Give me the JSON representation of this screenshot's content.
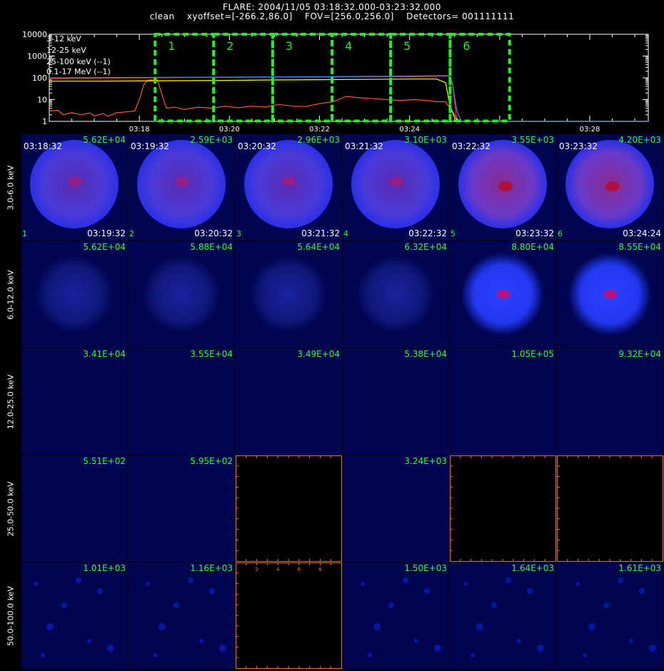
{
  "title_line1": "FLARE: 2004/11/05 03:18:32.000-03:23:32.000",
  "title_line2": "clean    xyoffset=[-266.2,86.0]    FOV=[256.0,256.0]    Detectors= 001111111",
  "chart_data": {
    "type": "line",
    "x_unit": "minutes after 03:16",
    "xlim": [
      0,
      13.3
    ],
    "x_ticks": [
      2,
      4,
      6,
      8,
      12
    ],
    "x_tick_labels": [
      "03:18",
      "03:20",
      "03:22",
      "03:24",
      "03:28"
    ],
    "yscale": "log",
    "ylim": [
      1,
      10000
    ],
    "y_ticks": [
      1,
      10,
      100,
      1000,
      10000
    ],
    "y_tick_labels": [
      "1",
      "10",
      "100",
      "1000",
      "10000"
    ],
    "legend_placement": "top-left",
    "series": [
      {
        "name": "3-12 keV",
        "color": "#ff2020",
        "x": [
          0,
          0.5,
          0.6,
          0.8,
          1.0,
          1.1,
          1.3,
          1.5,
          1.7,
          2.0,
          2.2,
          2.4,
          2.7,
          3.0,
          3.5,
          4.0,
          5.0,
          6.0,
          7.0,
          8.0,
          8.7,
          8.85,
          8.95,
          9.05,
          9.15,
          13.3
        ],
        "y": [
          90,
          92,
          95,
          93,
          96,
          95,
          97,
          96,
          98,
          98,
          100,
          100,
          101,
          102,
          104,
          105,
          106,
          108,
          110,
          112,
          120,
          120,
          60,
          1,
          1,
          1
        ]
      },
      {
        "name": "12-25 keV",
        "color": "#ff5a1e",
        "x": [
          0,
          0.2,
          0.3,
          0.5,
          0.7,
          0.9,
          1.0,
          1.2,
          1.3,
          1.5,
          1.7,
          1.9,
          2.0,
          2.1,
          2.2,
          2.4,
          2.6,
          2.8,
          3.0,
          3.3,
          3.6,
          3.9,
          4.2,
          4.5,
          4.8,
          5.1,
          5.4,
          5.7,
          6.0,
          6.3,
          6.6,
          6.9,
          7.2,
          7.5,
          7.8,
          8.1,
          8.4,
          8.6,
          8.8,
          8.9,
          9.0,
          9.1,
          13.3
        ],
        "y": [
          3,
          3.2,
          2,
          2.5,
          2,
          2.4,
          1.8,
          2.3,
          1.7,
          2.5,
          2.7,
          3,
          10,
          50,
          80,
          80,
          4,
          4.5,
          3.5,
          4.5,
          4,
          5,
          4.2,
          5,
          4.5,
          6,
          5,
          4.8,
          6.5,
          8,
          14,
          12,
          11,
          10,
          9,
          10,
          9,
          8,
          8,
          4,
          2,
          1,
          1
        ]
      },
      {
        "name": "25-100 keV (--1)",
        "color": "#ffff00",
        "x": [
          0,
          1,
          2,
          3,
          4,
          5,
          6,
          7,
          8,
          8.6,
          8.8,
          8.9,
          9.0,
          9.1,
          13.3
        ],
        "y": [
          70,
          70,
          72,
          74,
          76,
          80,
          82,
          85,
          88,
          88,
          60,
          5,
          1.5,
          1,
          1
        ]
      },
      {
        "name": "0.1-17 MeV (--1)",
        "color": "#2a8cff",
        "x": [
          0,
          1,
          2,
          3,
          4,
          5,
          6,
          7,
          8,
          8.7,
          8.85,
          8.95,
          9.05,
          9.15,
          13.3
        ],
        "y": [
          100,
          102,
          104,
          106,
          108,
          110,
          112,
          116,
          120,
          125,
          125,
          60,
          3,
          1,
          1
        ]
      }
    ],
    "intervals": [
      {
        "label": "1",
        "x": [
          2.35,
          3.65
        ]
      },
      {
        "label": "2",
        "x": [
          3.65,
          4.96
        ]
      },
      {
        "label": "3",
        "x": [
          4.96,
          6.28
        ]
      },
      {
        "label": "4",
        "x": [
          6.28,
          7.58
        ]
      },
      {
        "label": "5",
        "x": [
          7.58,
          8.9
        ]
      },
      {
        "label": "6",
        "x": [
          8.9,
          10.22
        ]
      }
    ]
  },
  "energy_bands": [
    "3.0-6.0 keV",
    "6.0-12.0 keV",
    "12.0-25.0 keV",
    "25.0-50.0 keV",
    "50.0-100.0 keV"
  ],
  "time_starts": [
    "03:18:32",
    "03:19:32",
    "03:20:32",
    "03:21:32",
    "03:22:32",
    "03:23:32"
  ],
  "time_ends": [
    "03:19:32",
    "03:20:32",
    "03:21:32",
    "03:22:32",
    "03:23:32",
    "03:24:24"
  ],
  "cell_numbers": [
    "1",
    "2",
    "3",
    "4",
    "5",
    "6"
  ],
  "image_peaks": [
    [
      "5.62E+04",
      "2.59E+03",
      "2.96E+03",
      "3.10E+03",
      "3.55E+03",
      "4.20E+03"
    ],
    [
      "5.62E+04",
      "5.88E+04",
      "5.64E+04",
      "6.32E+04",
      "8.80E+04",
      "8.55E+04"
    ],
    [
      "3.41E+04",
      "3.55E+04",
      "3.49E+04",
      "5.38E+04",
      "1.05E+05",
      "9.32E+04"
    ],
    [
      "5.51E+02",
      "5.95E+02",
      "",
      "3.24E+03",
      "",
      ""
    ],
    [
      "1.01E+03",
      "1.16E+03",
      "",
      "1.50E+03",
      "1.64E+03",
      "1.61E+03"
    ]
  ],
  "empty_panels": [
    [
      3,
      2
    ],
    [
      3,
      4
    ],
    [
      3,
      5
    ],
    [
      4,
      2
    ]
  ],
  "empty_axis_ticks": [
    "2",
    "4",
    "6",
    "8"
  ],
  "colors": {
    "background": "#000000",
    "panel_background": "#000552",
    "peak_label": "#2dff2d",
    "interval_box": "#22ee22",
    "empty_axis": "#ff6a28"
  }
}
